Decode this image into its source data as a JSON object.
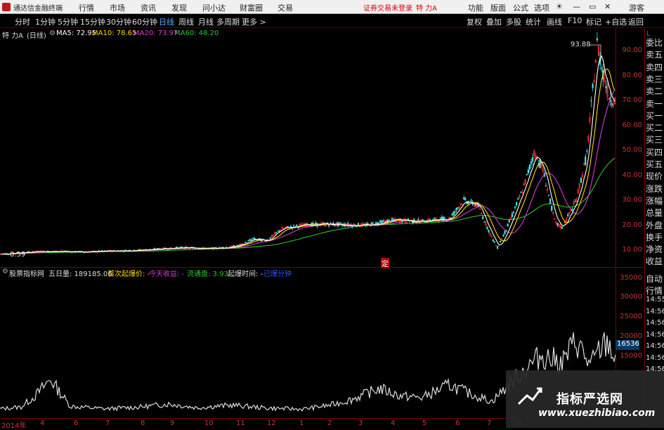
{
  "menubar": {
    "app_title": "通达信金融终端",
    "menus": [
      "行情",
      "市场",
      "资讯",
      "发现",
      "问小达",
      "财富圈",
      "交易"
    ],
    "login_status": "证券交易未登录",
    "stock_name": "特 力A",
    "tools": [
      "功能",
      "版面",
      "公式",
      "选项"
    ],
    "user": "游客"
  },
  "periodbar": {
    "periods": [
      "分时",
      "1分钟",
      "5分钟",
      "15分钟",
      "30分钟",
      "60分钟",
      "日线",
      "周线",
      "月线",
      "多周期",
      "更多 >"
    ],
    "active": "日线",
    "right_buttons": [
      "复权",
      "叠加",
      "多股",
      "统计",
      "画线",
      "F10",
      "标记",
      "+自选",
      "返回"
    ]
  },
  "main_info": {
    "stock": "特 力A",
    "period": "(日线)",
    "ma5": "MA5: 72.95",
    "ma10": "MA10: 78.65",
    "ma20": "MA20: 73.97",
    "ma60": "MA60: 48.20",
    "high_label": "93.88",
    "low_label": "8.39",
    "marker": "定"
  },
  "price_axis": [
    "90.00",
    "80.00",
    "70.00",
    "60.00",
    "50.00",
    "40.00",
    "30.00",
    "20.00",
    "10.00"
  ],
  "indicator_info": {
    "name": "股票指标网",
    "five_day_vol": "五日量: 189185.06",
    "first_price": "首次起爆价: -",
    "today_gain": "今天收益: -",
    "float_cap": "流通盘: 3.93",
    "start_time": "起爆时间: -",
    "status": "已爆分钟"
  },
  "vol_axis": [
    "35000",
    "30000",
    "25000",
    "20000",
    "15000"
  ],
  "vol_badge": "16536",
  "date_axis": [
    "2014年",
    "4",
    "6",
    "7",
    "8",
    "9",
    "10",
    "11",
    "12",
    "1",
    "2",
    "3",
    "4",
    "5",
    "6",
    "7",
    "8"
  ],
  "right_panel": [
    "委比",
    "卖五",
    "卖四",
    "卖三",
    "卖二",
    "卖一",
    "买一",
    "买二",
    "买三",
    "买四",
    "买五",
    "现价",
    "涨跌",
    "涨幅",
    "总量",
    "外盘",
    "换手",
    "净资",
    "收益",
    "自动",
    "行情",
    "14:55",
    "14:56",
    "14:56",
    "14:56",
    "14:56",
    "14:56",
    "14:56"
  ],
  "watermark": {
    "title": "指标严选网",
    "url": "www.xuezhibiao.com"
  },
  "colors": {
    "ma5": "#ffffff",
    "ma10": "#ffd700",
    "ma20": "#d040d0",
    "ma60": "#30c030",
    "axis_red": "#c33",
    "up": "#ff3030",
    "down": "#50e0e0"
  }
}
